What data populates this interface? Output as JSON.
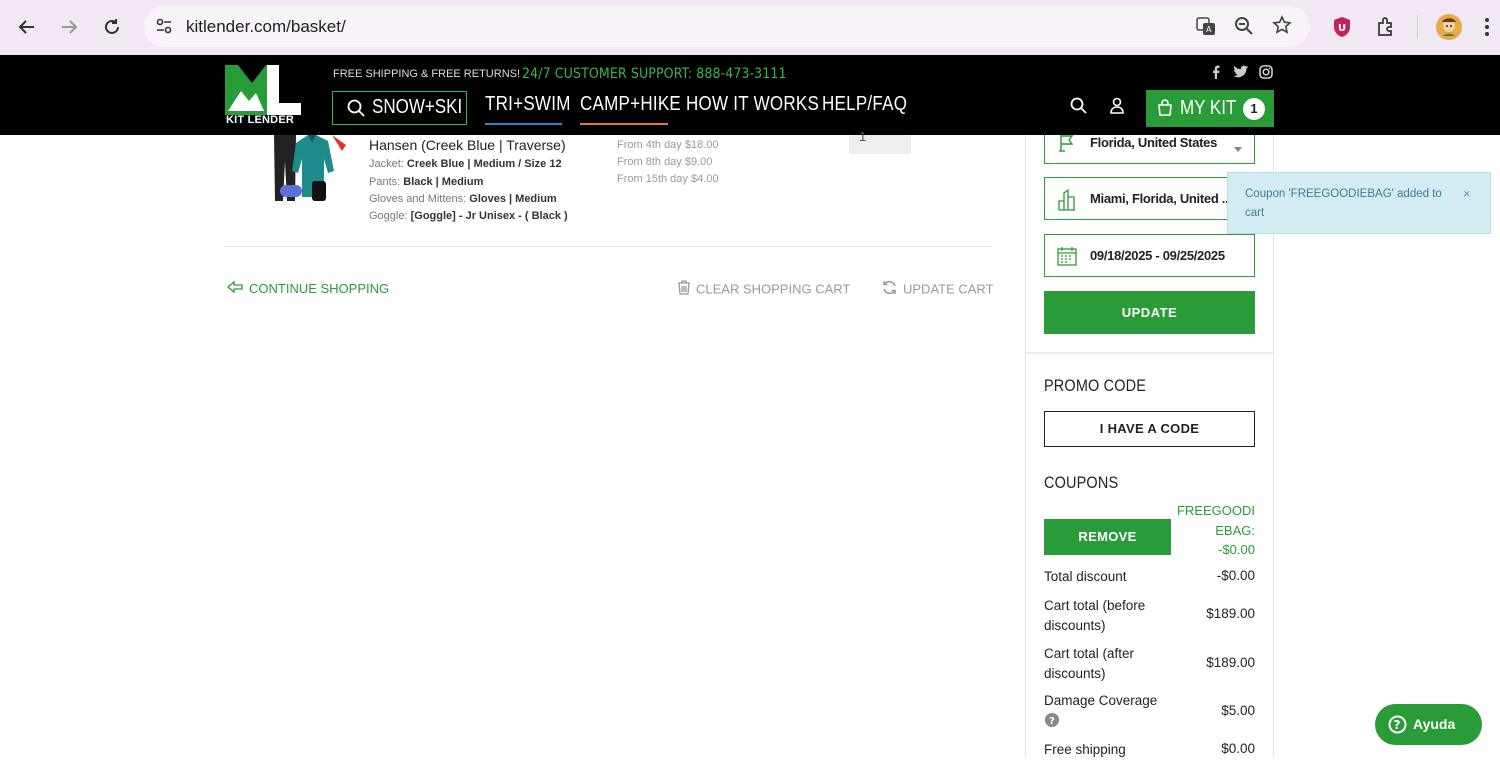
{
  "browser": {
    "url": "kitlender.com/basket/"
  },
  "header": {
    "logo_text": "KIT LENDER",
    "free_shipping": "FREE SHIPPING & FREE RETURNS!",
    "support": "24/7 CUSTOMER SUPPORT: 888-473-3111",
    "menu": [
      "SNOW+SKI",
      "TRI+SWIM",
      "CAMP+HIKE",
      "HOW IT WORKS",
      "HELP/FAQ"
    ],
    "mykit_label": "MY KIT",
    "mykit_count": "1"
  },
  "cart_item": {
    "title": "Hansen (Creek Blue | Traverse)",
    "attributes": [
      {
        "label": "Jacket: ",
        "value": "Creek Blue | Medium / Size 12"
      },
      {
        "label": "Pants: ",
        "value": "Black | Medium"
      },
      {
        "label": "Gloves and Mittens: ",
        "value": "Gloves | Medium"
      },
      {
        "label": "Goggle: ",
        "value": "[Goggle] - Jr Unisex - ( Black )"
      }
    ],
    "pricing": [
      "From 4th day $18.00",
      "From 8th day $9.00",
      "From 15th day $4.00"
    ],
    "qty": "1"
  },
  "actions": {
    "continue": "CONTINUE SHOPPING",
    "clear": "CLEAR SHOPPING CART",
    "update": "UPDATE CART"
  },
  "sidebar": {
    "state": "Florida, United States",
    "city": "Miami, Florida, United ...",
    "dates": "09/18/2025 - 09/25/2025",
    "update_button": "UPDATE",
    "promo_title": "PROMO CODE",
    "promo_button": "I HAVE A CODE",
    "coupons_title": "COUPONS",
    "remove_button": "REMOVE",
    "coupon_line1": "FREEGOODI",
    "coupon_line2": "EBAG:",
    "coupon_line3": "-$0.00",
    "summary": {
      "total_discount_label": "Total discount",
      "total_discount_value": "-$0.00",
      "before_label_1": "Cart total (before",
      "before_label_2": "discounts)",
      "before_value": "$189.00",
      "after_label_1": "Cart total (after",
      "after_label_2": "discounts)",
      "after_value": "$189.00",
      "damage_label": "Damage Coverage",
      "damage_value": "$5.00",
      "shipping_label": "Free shipping",
      "shipping_value": "$0.00"
    }
  },
  "toast": {
    "message": "Coupon 'FREEGOODIEBAG' added to cart",
    "close": "×"
  },
  "help": {
    "label": "Ayuda"
  },
  "colors": {
    "brand_green": "#2a9b39",
    "header_bg": "#000000",
    "toast_bg": "#d2ecf2"
  }
}
